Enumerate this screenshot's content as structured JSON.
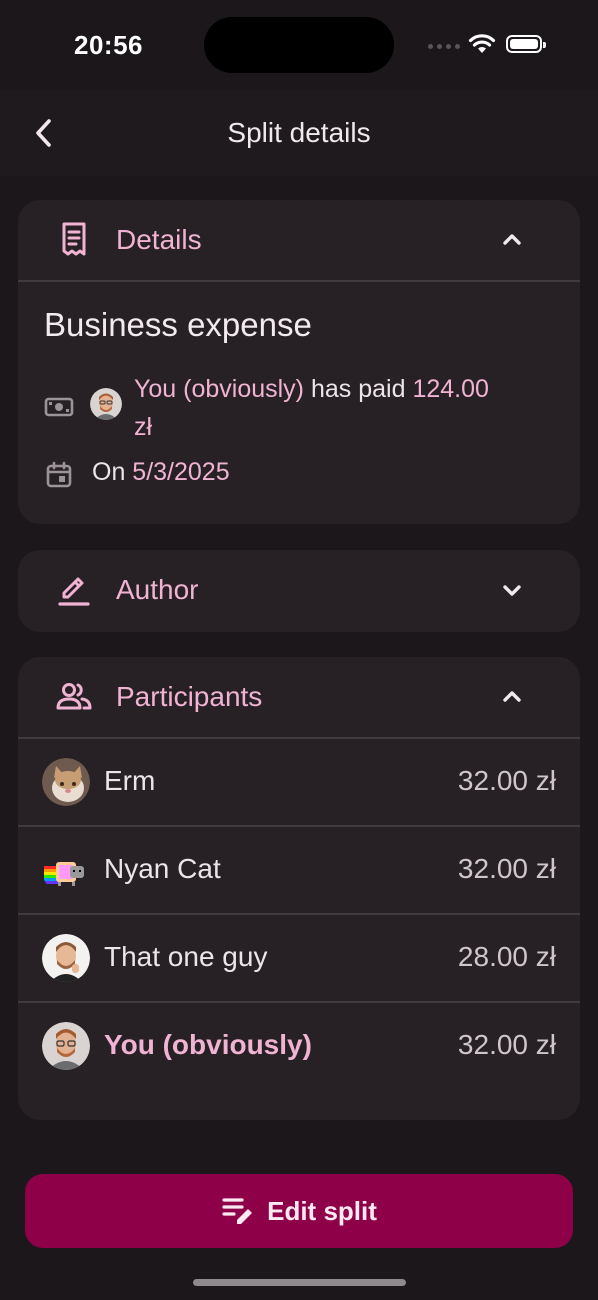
{
  "status_bar": {
    "time": "20:56"
  },
  "header": {
    "title": "Split details",
    "back_icon": "chevron-left-icon"
  },
  "details": {
    "section_label": "Details",
    "icon": "receipt-icon",
    "expanded": true,
    "title": "Business expense",
    "payer_name": "You (obviously)",
    "paid_text": " has paid ",
    "amount": "124.00",
    "currency": "zł",
    "date_prefix": "On ",
    "date": "5/3/2025"
  },
  "author": {
    "section_label": "Author",
    "icon": "pencil-icon",
    "expanded": false
  },
  "participants": {
    "section_label": "Participants",
    "icon": "people-icon",
    "expanded": true,
    "items": [
      {
        "name": "Erm",
        "amount": "32.00 zł",
        "is_you": false
      },
      {
        "name": "Nyan Cat",
        "amount": "32.00 zł",
        "is_you": false
      },
      {
        "name": "That one guy",
        "amount": "28.00 zł",
        "is_you": false
      },
      {
        "name": "You (obviously)",
        "amount": "32.00 zł",
        "is_you": true
      }
    ]
  },
  "actions": {
    "edit_label": "Edit split",
    "edit_icon": "edit-list-icon"
  },
  "colors": {
    "accent": "#f0b3d3",
    "button": "#8e0048",
    "background": "#1c171b",
    "card": "#272125"
  }
}
